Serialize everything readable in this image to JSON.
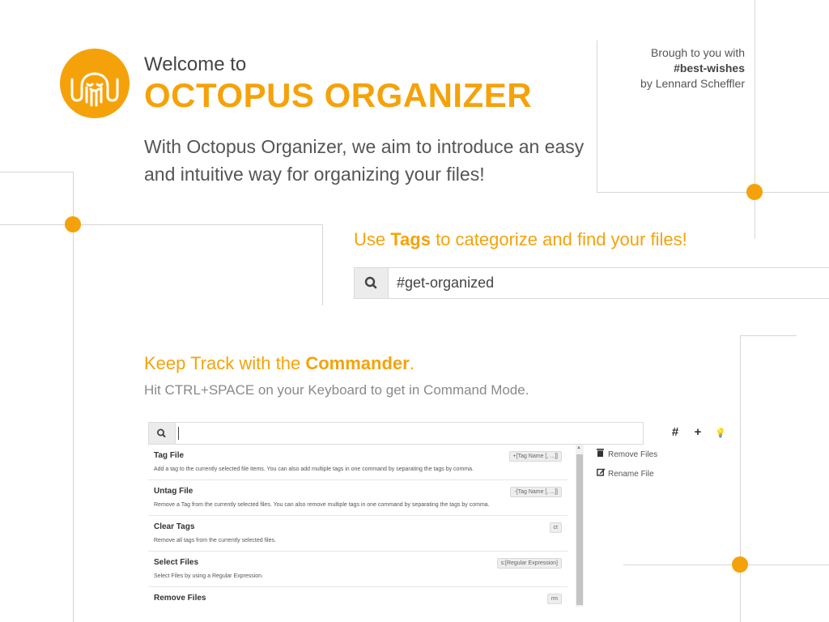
{
  "header": {
    "welcome": "Welcome to",
    "brand": "OCTOPUS ORGANIZER",
    "intro": "With Octopus Organizer, we aim to introduce an easy and intuitive way for organizing your files!"
  },
  "credit": {
    "line1": "Brough to you with",
    "hashtag": "#best-wishes",
    "line3": "by Lennard Scheffler"
  },
  "tags": {
    "title_prefix": "Use ",
    "title_bold": "Tags",
    "title_suffix": " to categorize and find your files!",
    "search_value": "#get-organized",
    "search_icon": "search-icon"
  },
  "commander": {
    "title_prefix": "Keep Track with the ",
    "title_bold": "Commander",
    "title_suffix": ".",
    "subtitle": "Hit CTRL+SPACE on your Keyboard to get in Command Mode.",
    "search_value": "",
    "toolbar": {
      "hash": "#",
      "plus": "+",
      "bulb": "💡"
    },
    "commands": [
      {
        "name": "Tag File",
        "desc": "Add a tag to the currently selected file items. You can also add multiple tags in one command by separating the tags by comma.",
        "shortcut": "+[Tag Name [, ...]]"
      },
      {
        "name": "Untag File",
        "desc": "Remove a Tag from the currently selected files. You can also remove multiple tags in one command by separating the tags by comma.",
        "shortcut": "-[Tag Name [, ...]]"
      },
      {
        "name": "Clear Tags",
        "desc": "Remove all tags from the currently selected files.",
        "shortcut": "ct"
      },
      {
        "name": "Select Files",
        "desc": "Select Files by using a Regular Expression.",
        "shortcut": "s:[Regular Expression]"
      },
      {
        "name": "Remove Files",
        "desc": "",
        "shortcut": "rm"
      }
    ],
    "side_actions": [
      {
        "label": "Remove Files",
        "icon": "trash-icon"
      },
      {
        "label": "Rename File",
        "icon": "edit-icon"
      }
    ]
  },
  "colors": {
    "accent": "#f5a20a",
    "line": "#d6d6d6",
    "text": "#555555"
  }
}
